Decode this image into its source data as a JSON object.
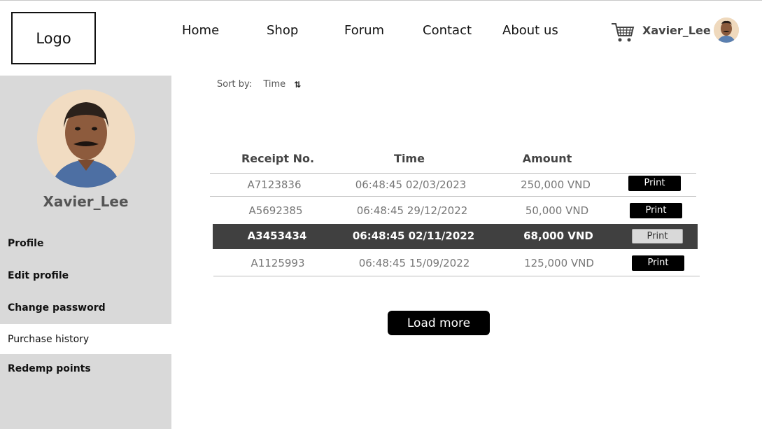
{
  "logo": "Logo",
  "nav": [
    "Home",
    "Shop",
    "Forum",
    "Contact",
    "About us"
  ],
  "user": {
    "name": "Xavier_Lee"
  },
  "sidebar": {
    "name": "Xavier_Lee",
    "items": [
      {
        "label": "Profile",
        "active": false
      },
      {
        "label": "Edit profile",
        "active": false
      },
      {
        "label": "Change password",
        "active": false
      },
      {
        "label": "Purchase history",
        "active": true
      },
      {
        "label": "Redemp points",
        "active": false
      }
    ]
  },
  "sort": {
    "label": "Sort by:",
    "value": "Time"
  },
  "table": {
    "headers": [
      "Receipt No.",
      "Time",
      "Amount"
    ],
    "rows": [
      {
        "receipt": "A7123836",
        "time": "06:48:45 02/03/2023",
        "amount": "250,000 VND",
        "action": "Print",
        "selected": false
      },
      {
        "receipt": "A5692385",
        "time": "06:48:45 29/12/2022",
        "amount": "50,000 VND",
        "action": "Print",
        "selected": false
      },
      {
        "receipt": "A3453434",
        "time": "06:48:45 02/11/2022",
        "amount": "68,000 VND",
        "action": "Print",
        "selected": true
      },
      {
        "receipt": "A1125993",
        "time": "06:48:45 15/09/2022",
        "amount": "125,000 VND",
        "action": "Print",
        "selected": false
      }
    ]
  },
  "load_more": "Load more",
  "colors": {
    "sidebar_bg": "#d9d9d9",
    "selected_row": "#404040",
    "button": "#000000"
  }
}
